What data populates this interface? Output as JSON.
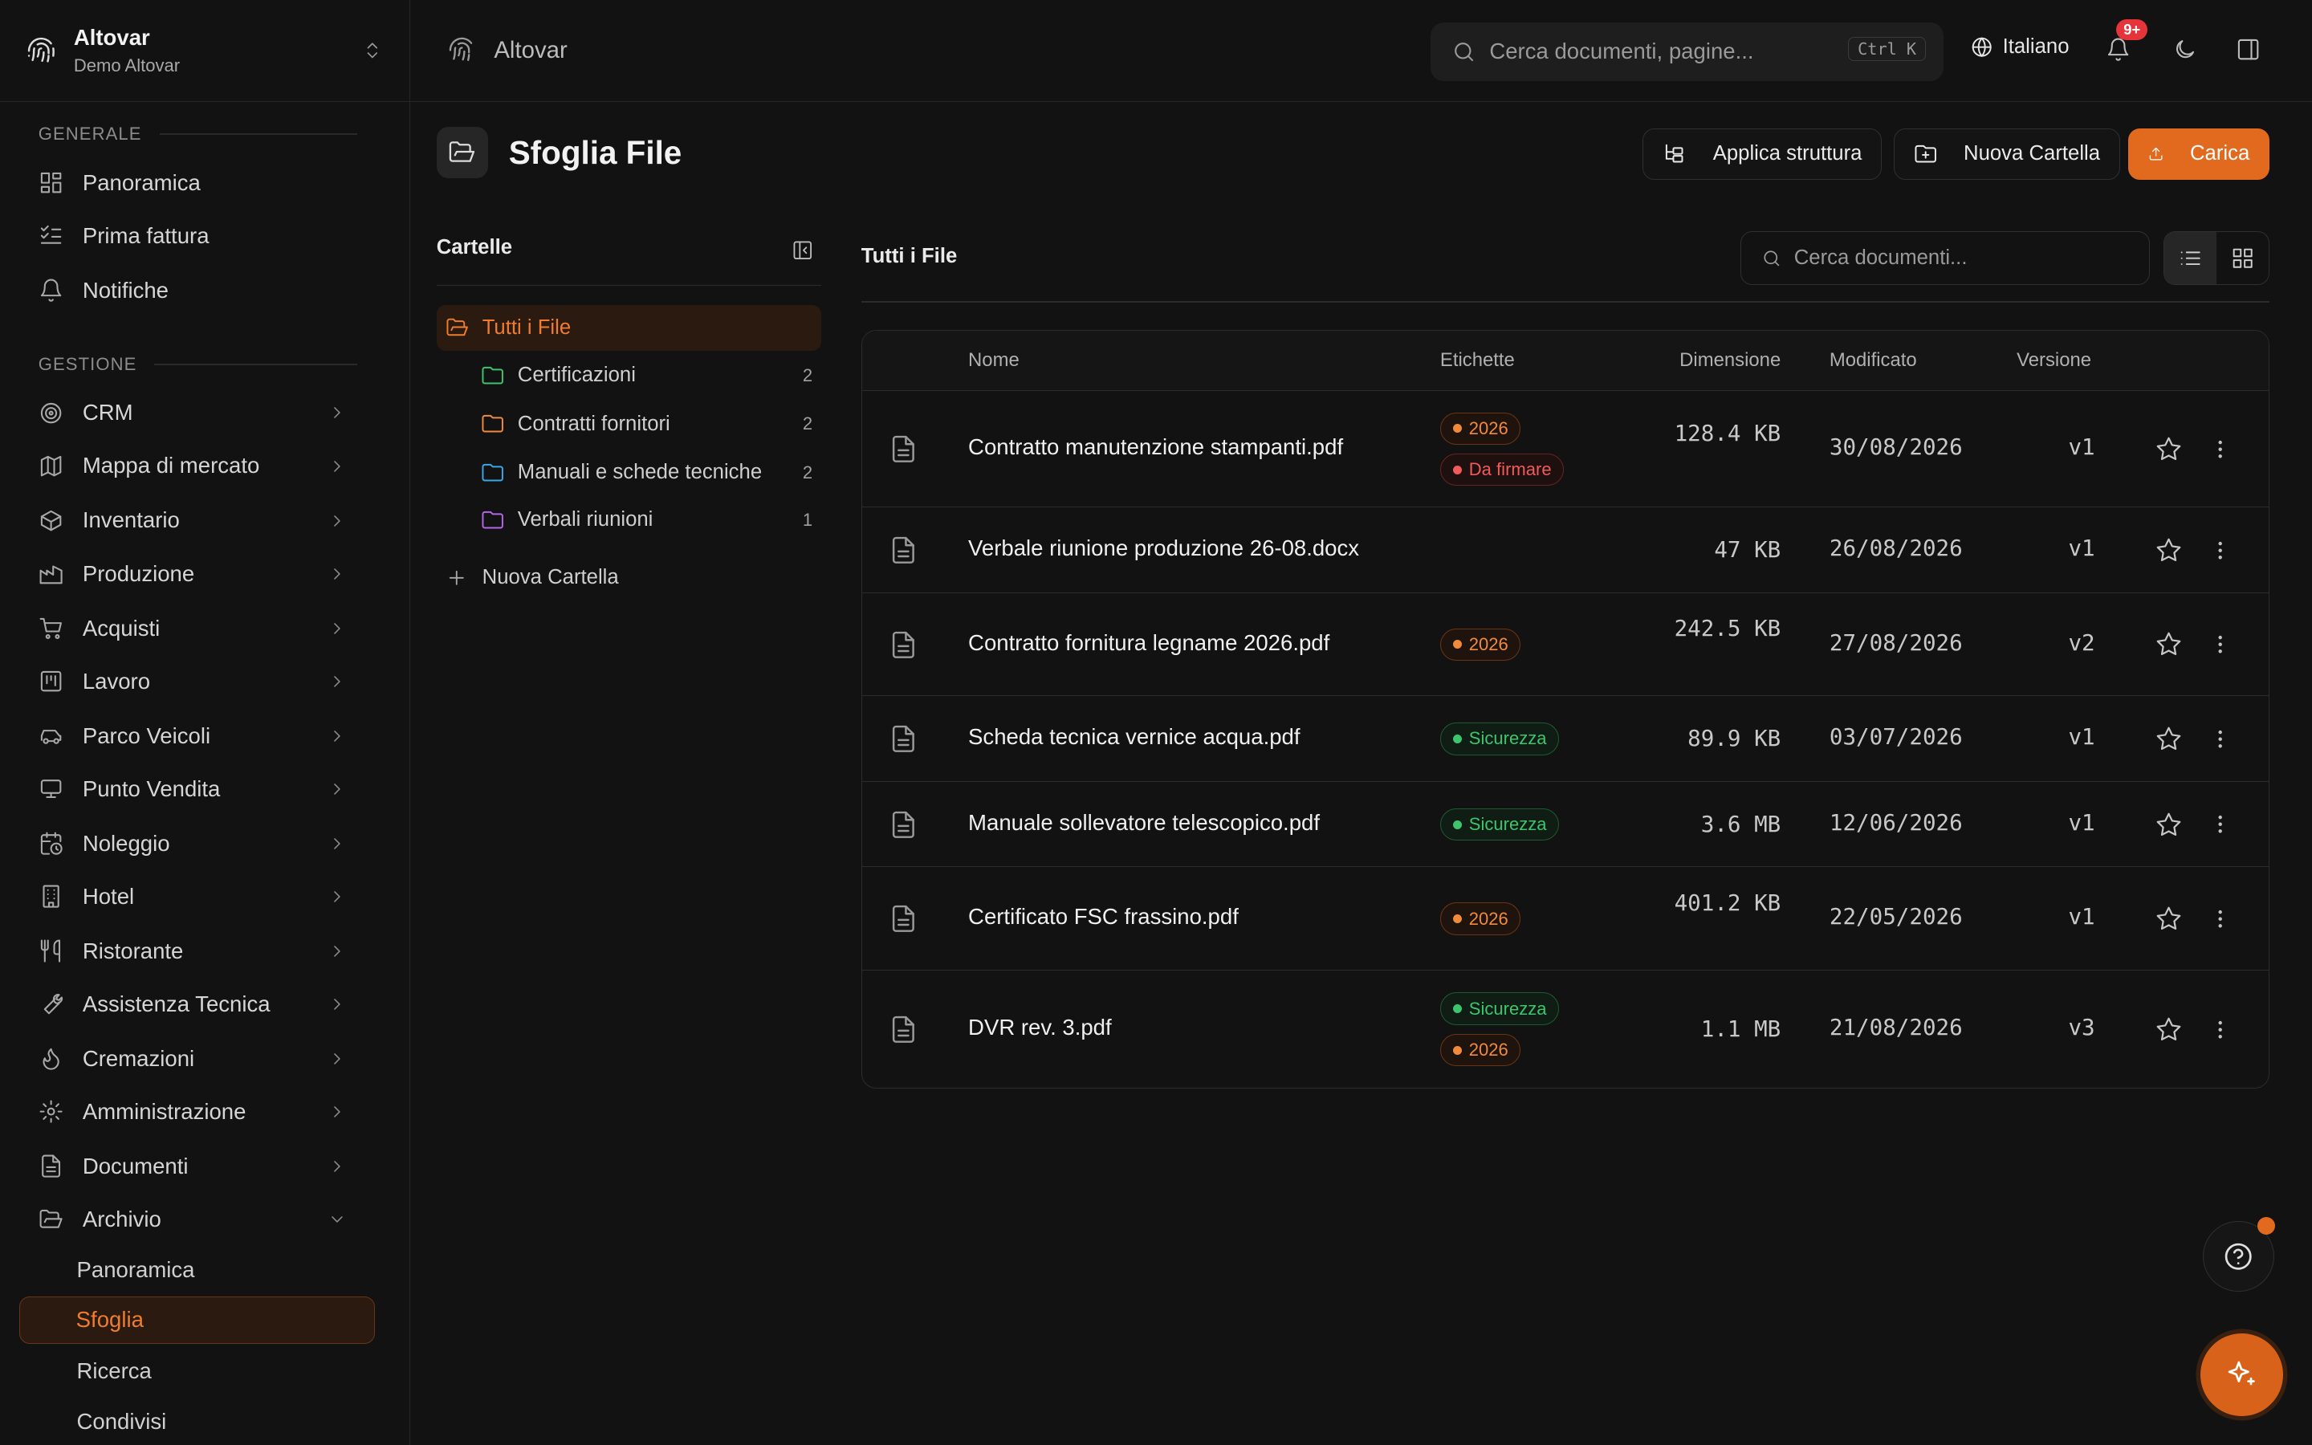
{
  "brand": {
    "name": "Altovar",
    "org": "Demo Altovar"
  },
  "sidebar": {
    "sections": [
      {
        "label": "GENERALE"
      },
      {
        "label": "GESTIONE"
      }
    ],
    "general": [
      {
        "label": "Panoramica",
        "icon": "grid-icon"
      },
      {
        "label": "Prima fattura",
        "icon": "checklist-icon"
      },
      {
        "label": "Notifiche",
        "icon": "bell-icon"
      }
    ],
    "management": [
      {
        "label": "CRM",
        "icon": "target-icon"
      },
      {
        "label": "Mappa di mercato",
        "icon": "map-icon"
      },
      {
        "label": "Inventario",
        "icon": "box-icon"
      },
      {
        "label": "Produzione",
        "icon": "factory-icon"
      },
      {
        "label": "Acquisti",
        "icon": "cart-icon"
      },
      {
        "label": "Lavoro",
        "icon": "kanban-icon"
      },
      {
        "label": "Parco Veicoli",
        "icon": "car-icon"
      },
      {
        "label": "Punto Vendita",
        "icon": "monitor-icon"
      },
      {
        "label": "Noleggio",
        "icon": "calendar-clock-icon"
      },
      {
        "label": "Hotel",
        "icon": "building-icon"
      },
      {
        "label": "Ristorante",
        "icon": "utensils-icon"
      },
      {
        "label": "Assistenza Tecnica",
        "icon": "wrench-icon"
      },
      {
        "label": "Cremazioni",
        "icon": "flame-icon"
      },
      {
        "label": "Amministrazione",
        "icon": "gear-icon"
      },
      {
        "label": "Documenti",
        "icon": "document-icon"
      },
      {
        "label": "Archivio",
        "icon": "folder-open-icon"
      }
    ],
    "archive_sub": [
      {
        "label": "Panoramica"
      },
      {
        "label": "Sfoglia"
      },
      {
        "label": "Ricerca"
      },
      {
        "label": "Condivisi"
      }
    ]
  },
  "topbar": {
    "crumb": "Altovar",
    "search_placeholder": "Cerca documenti, pagine...",
    "shortcut": "Ctrl K",
    "language": "Italiano",
    "notif_badge": "9+"
  },
  "page": {
    "title": "Sfoglia File",
    "actions": {
      "apply": "Applica struttura",
      "new_folder": "Nuova Cartella",
      "upload": "Carica"
    }
  },
  "folders": {
    "title": "Cartelle",
    "all": "Tutti i File",
    "items": [
      {
        "label": "Certificazioni",
        "count": "2",
        "color": "#3ec46d"
      },
      {
        "label": "Contratti fornitori",
        "count": "2",
        "color": "#f08a3c"
      },
      {
        "label": "Manuali e schede tecniche",
        "count": "2",
        "color": "#3aa6e8"
      },
      {
        "label": "Verbali riunioni",
        "count": "1",
        "color": "#b366e8"
      }
    ],
    "new": "Nuova Cartella"
  },
  "files": {
    "title": "Tutti i File",
    "search_placeholder": "Cerca documenti...",
    "columns": {
      "name": "Nome",
      "tags": "Etichette",
      "size": "Dimensione",
      "modified": "Modificato",
      "version": "Versione"
    },
    "rows": [
      {
        "name": "Contratto manutenzione stampanti.pdf",
        "tags": [
          {
            "t": "2026",
            "c": "orange"
          },
          {
            "t": "Da firmare",
            "c": "red"
          }
        ],
        "size": "128.4 KB",
        "modified": "30/08/2026",
        "version": "v1"
      },
      {
        "name": "Verbale riunione produzione 26-08.docx",
        "tags": [],
        "size": "47 KB",
        "modified": "26/08/2026",
        "version": "v1"
      },
      {
        "name": "Contratto fornitura legname 2026.pdf",
        "tags": [
          {
            "t": "2026",
            "c": "orange"
          }
        ],
        "size": "242.5 KB",
        "modified": "27/08/2026",
        "version": "v2"
      },
      {
        "name": "Scheda tecnica vernice acqua.pdf",
        "tags": [
          {
            "t": "Sicurezza",
            "c": "green"
          }
        ],
        "size": "89.9 KB",
        "modified": "03/07/2026",
        "version": "v1"
      },
      {
        "name": "Manuale sollevatore telescopico.pdf",
        "tags": [
          {
            "t": "Sicurezza",
            "c": "green"
          }
        ],
        "size": "3.6 MB",
        "modified": "12/06/2026",
        "version": "v1"
      },
      {
        "name": "Certificato FSC frassino.pdf",
        "tags": [
          {
            "t": "2026",
            "c": "orange"
          }
        ],
        "size": "401.2 KB",
        "modified": "22/05/2026",
        "version": "v1"
      },
      {
        "name": "DVR rev. 3.pdf",
        "tags": [
          {
            "t": "Sicurezza",
            "c": "green"
          },
          {
            "t": "2026",
            "c": "orange"
          }
        ],
        "size": "1.1 MB",
        "modified": "21/08/2026",
        "version": "v3"
      }
    ]
  },
  "colors": {
    "accent": "#e26a1f",
    "background": "#121212",
    "border": "#2c2c2c"
  }
}
